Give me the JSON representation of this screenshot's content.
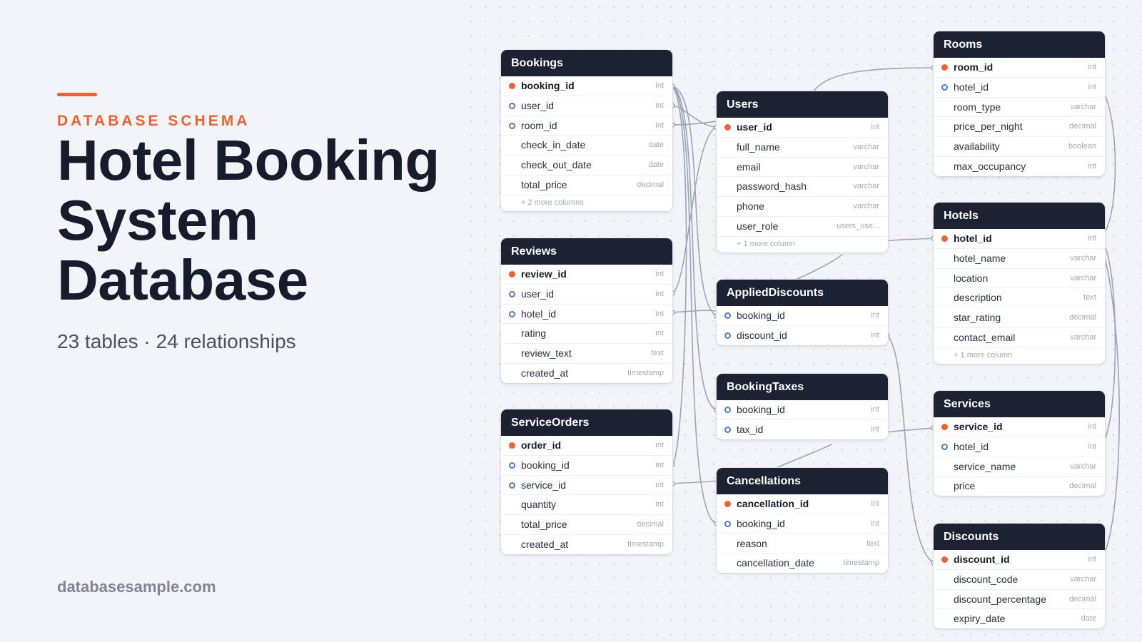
{
  "header": {
    "kicker": "DATABASE SCHEMA",
    "title": "Hotel Booking System Database",
    "stats": "23 tables · 24 relationships",
    "site": "databasesample.com"
  },
  "colors": {
    "accent": "#ee6232",
    "header_bg": "#1d2233",
    "fk_ring": "#4f7cc2",
    "link": "#9ba5b8"
  },
  "tables": [
    {
      "name": "Bookings",
      "columns": [
        {
          "name": "booking_id",
          "type": "int",
          "key": "pk"
        },
        {
          "name": "user_id",
          "type": "int",
          "key": "fk"
        },
        {
          "name": "room_id",
          "type": "int",
          "key": "fk"
        },
        {
          "name": "check_in_date",
          "type": "date",
          "key": ""
        },
        {
          "name": "check_out_date",
          "type": "date",
          "key": ""
        },
        {
          "name": "total_price",
          "type": "decimal",
          "key": ""
        }
      ],
      "more": "+ 2 more columns"
    },
    {
      "name": "Reviews",
      "columns": [
        {
          "name": "review_id",
          "type": "int",
          "key": "pk"
        },
        {
          "name": "user_id",
          "type": "int",
          "key": "fk"
        },
        {
          "name": "hotel_id",
          "type": "int",
          "key": "fk"
        },
        {
          "name": "rating",
          "type": "int",
          "key": ""
        },
        {
          "name": "review_text",
          "type": "text",
          "key": ""
        },
        {
          "name": "created_at",
          "type": "timestamp",
          "key": ""
        }
      ],
      "more": ""
    },
    {
      "name": "ServiceOrders",
      "columns": [
        {
          "name": "order_id",
          "type": "int",
          "key": "pk"
        },
        {
          "name": "booking_id",
          "type": "int",
          "key": "fk"
        },
        {
          "name": "service_id",
          "type": "int",
          "key": "fk"
        },
        {
          "name": "quantity",
          "type": "int",
          "key": ""
        },
        {
          "name": "total_price",
          "type": "decimal",
          "key": ""
        },
        {
          "name": "created_at",
          "type": "timestamp",
          "key": ""
        }
      ],
      "more": ""
    },
    {
      "name": "Users",
      "columns": [
        {
          "name": "user_id",
          "type": "int",
          "key": "pk"
        },
        {
          "name": "full_name",
          "type": "varchar",
          "key": ""
        },
        {
          "name": "email",
          "type": "varchar",
          "key": ""
        },
        {
          "name": "password_hash",
          "type": "varchar",
          "key": ""
        },
        {
          "name": "phone",
          "type": "varchar",
          "key": ""
        },
        {
          "name": "user_role",
          "type": "users_use...",
          "key": ""
        }
      ],
      "more": "+ 1 more column"
    },
    {
      "name": "AppliedDiscounts",
      "columns": [
        {
          "name": "booking_id",
          "type": "int",
          "key": "fk"
        },
        {
          "name": "discount_id",
          "type": "int",
          "key": "fk"
        }
      ],
      "more": ""
    },
    {
      "name": "BookingTaxes",
      "columns": [
        {
          "name": "booking_id",
          "type": "int",
          "key": "fk"
        },
        {
          "name": "tax_id",
          "type": "int",
          "key": "fk"
        }
      ],
      "more": ""
    },
    {
      "name": "Cancellations",
      "columns": [
        {
          "name": "cancellation_id",
          "type": "int",
          "key": "pk"
        },
        {
          "name": "booking_id",
          "type": "int",
          "key": "fk"
        },
        {
          "name": "reason",
          "type": "text",
          "key": ""
        },
        {
          "name": "cancellation_date",
          "type": "timestamp",
          "key": ""
        }
      ],
      "more": ""
    },
    {
      "name": "Rooms",
      "columns": [
        {
          "name": "room_id",
          "type": "int",
          "key": "pk"
        },
        {
          "name": "hotel_id",
          "type": "int",
          "key": "fk"
        },
        {
          "name": "room_type",
          "type": "varchar",
          "key": ""
        },
        {
          "name": "price_per_night",
          "type": "decimal",
          "key": ""
        },
        {
          "name": "availability",
          "type": "boolean",
          "key": ""
        },
        {
          "name": "max_occupancy",
          "type": "int",
          "key": ""
        }
      ],
      "more": ""
    },
    {
      "name": "Hotels",
      "columns": [
        {
          "name": "hotel_id",
          "type": "int",
          "key": "pk"
        },
        {
          "name": "hotel_name",
          "type": "varchar",
          "key": ""
        },
        {
          "name": "location",
          "type": "varchar",
          "key": ""
        },
        {
          "name": "description",
          "type": "text",
          "key": ""
        },
        {
          "name": "star_rating",
          "type": "decimal",
          "key": ""
        },
        {
          "name": "contact_email",
          "type": "varchar",
          "key": ""
        }
      ],
      "more": "+ 1 more column"
    },
    {
      "name": "Services",
      "columns": [
        {
          "name": "service_id",
          "type": "int",
          "key": "pk"
        },
        {
          "name": "hotel_id",
          "type": "int",
          "key": "fk"
        },
        {
          "name": "service_name",
          "type": "varchar",
          "key": ""
        },
        {
          "name": "price",
          "type": "decimal",
          "key": ""
        }
      ],
      "more": ""
    },
    {
      "name": "Discounts",
      "columns": [
        {
          "name": "discount_id",
          "type": "int",
          "key": "pk"
        },
        {
          "name": "discount_code",
          "type": "varchar",
          "key": ""
        },
        {
          "name": "discount_percentage",
          "type": "decimal",
          "key": ""
        },
        {
          "name": "expiry_date",
          "type": "date",
          "key": ""
        }
      ],
      "more": ""
    }
  ]
}
